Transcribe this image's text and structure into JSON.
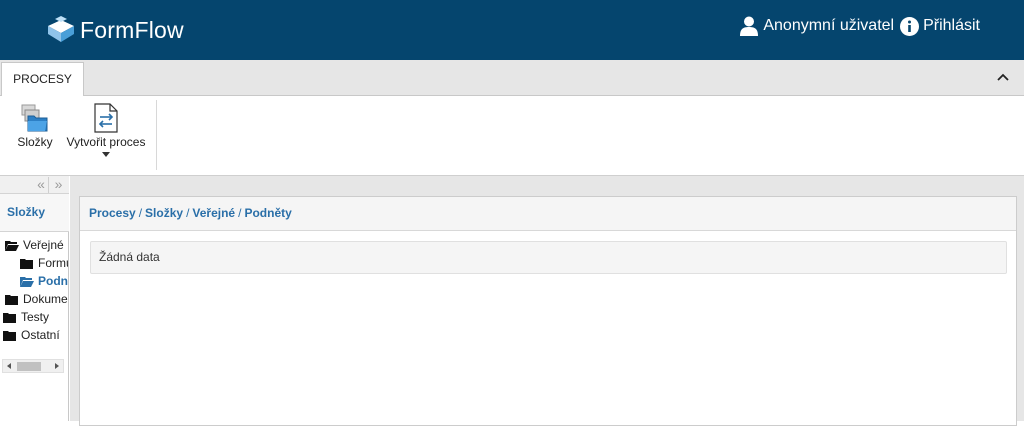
{
  "app": {
    "name": "FormFlow"
  },
  "header": {
    "user_label": "Anonymní uživatel",
    "login_label": "Přihlásit",
    "bg_color": "#05456e"
  },
  "tabs": [
    {
      "label": "PROCESY",
      "active": true
    }
  ],
  "ribbon": {
    "folders_label": "Složky",
    "create_process_label": "Vytvořit proces"
  },
  "sidebar": {
    "title": "Složky",
    "tree": [
      {
        "label": "Veřejné",
        "icon": "folder-open-icon",
        "level": 0,
        "active": false
      },
      {
        "label": "Formuláře",
        "icon": "folder-icon",
        "level": 1,
        "active": false
      },
      {
        "label": "Podněty",
        "icon": "folder-open-icon",
        "level": 1,
        "active": true
      },
      {
        "label": "Dokumenty",
        "icon": "folder-icon",
        "level": 0,
        "active": false
      },
      {
        "label": "Testy",
        "icon": "folder-icon",
        "level": 0,
        "active": false
      },
      {
        "label": "Ostatní",
        "icon": "folder-icon",
        "level": 0,
        "active": false
      }
    ]
  },
  "breadcrumb": [
    "Procesy",
    "Složky",
    "Veřejné",
    "Podněty"
  ],
  "main": {
    "empty_text": "Žádná data"
  },
  "colors": {
    "accent": "#2a6fa8",
    "header_bg": "#05456e"
  }
}
